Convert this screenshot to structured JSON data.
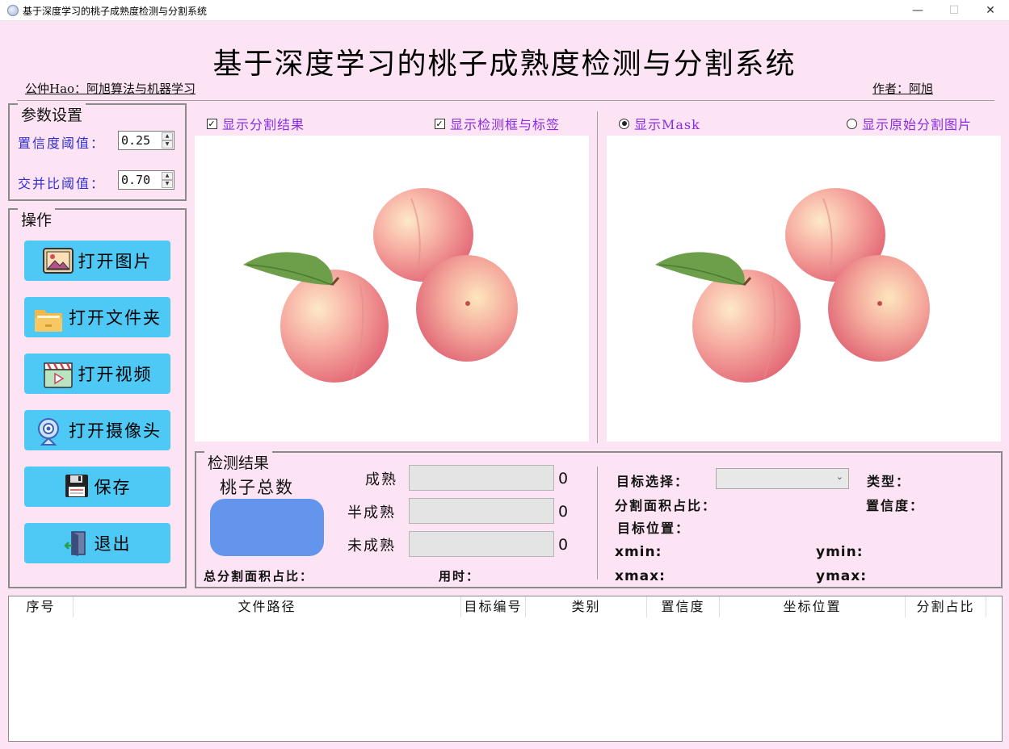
{
  "window": {
    "title": "基于深度学习的桃子成熟度检测与分割系统",
    "minimize_glyph": "—",
    "maximize_glyph": "☐",
    "close_glyph": "✕"
  },
  "header": {
    "title": "基于深度学习的桃子成熟度检测与分割系统",
    "left_note": "公仲Hao：阿旭算法与机器学习",
    "author": "作者：阿旭"
  },
  "params": {
    "group_title": "参数设置",
    "conf_label": "置信度阈值：",
    "conf_value": "0.25",
    "iou_label": "交并比阈值：",
    "iou_value": "0.70"
  },
  "ops": {
    "group_title": "操作",
    "buttons": [
      {
        "label": "打开图片",
        "icon": "image-icon"
      },
      {
        "label": "打开文件夹",
        "icon": "folder-icon"
      },
      {
        "label": "打开视频",
        "icon": "video-icon"
      },
      {
        "label": "打开摄像头",
        "icon": "webcam-icon"
      },
      {
        "label": "保存",
        "icon": "floppy-save-icon"
      },
      {
        "label": "退出",
        "icon": "exit-door-icon"
      }
    ]
  },
  "view": {
    "show_seg": "显示分割结果",
    "show_box": "显示检测框与标签",
    "show_mask": "显示Mask",
    "show_orig_seg": "显示原始分割图片",
    "show_seg_checked": true,
    "show_box_checked": true,
    "mask_selected": true
  },
  "results": {
    "group_title": "检测结果",
    "total_label": "桃子总数",
    "total_badge_color": "#6495ed",
    "ripe_label": "成熟",
    "ripe_count": "0",
    "half_label": "半成熟",
    "half_count": "0",
    "unripe_label": "未成熟",
    "unripe_count": "0",
    "total_area_label": "总分割面积占比：",
    "time_label": "用时：",
    "target_select_label": "目标选择：",
    "type_label": "类型：",
    "seg_area_label": "分割面积占比：",
    "conf_label": "置信度：",
    "pos_label": "目标位置：",
    "xmin_label": "xmin:",
    "ymin_label": "ymin:",
    "xmax_label": "xmax:",
    "ymax_label": "ymax:"
  },
  "table": {
    "columns": [
      "序号",
      "文件路径",
      "目标编号",
      "类别",
      "置信度",
      "坐标位置",
      "分割占比"
    ]
  },
  "colors": {
    "background": "#fde4f4",
    "button": "#4ec8f4",
    "param_label": "#3030d0",
    "checkbox_label": "#8a2be2"
  }
}
